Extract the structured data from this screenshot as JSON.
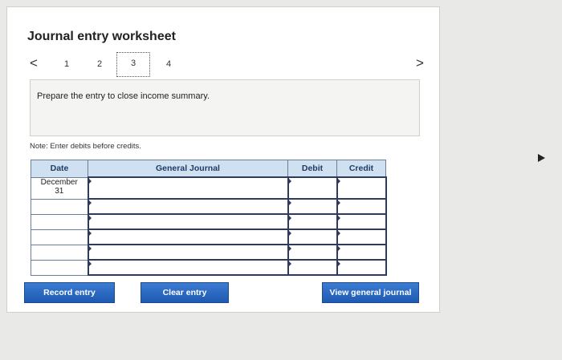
{
  "page": {
    "title": "Journal entry worksheet"
  },
  "pager": {
    "prev_icon": "chevron-left-icon",
    "next_icon": "chevron-right-icon",
    "prev_glyph": "<",
    "next_glyph": ">",
    "pages": [
      "1",
      "2",
      "3",
      "4"
    ],
    "active_page": "3"
  },
  "prompt": {
    "text": "Prepare the entry to close income summary."
  },
  "note": {
    "text": "Note: Enter debits before credits."
  },
  "table": {
    "headers": {
      "date": "Date",
      "journal": "General Journal",
      "debit": "Debit",
      "credit": "Credit"
    },
    "first_date": {
      "month": "December",
      "day": "31"
    }
  },
  "buttons": {
    "record": "Record entry",
    "clear": "Clear entry",
    "view": "View general journal"
  },
  "colors": {
    "button_blue": "#1d5ab3",
    "header_bg": "#cfe0f1",
    "header_text": "#1f3b66"
  }
}
